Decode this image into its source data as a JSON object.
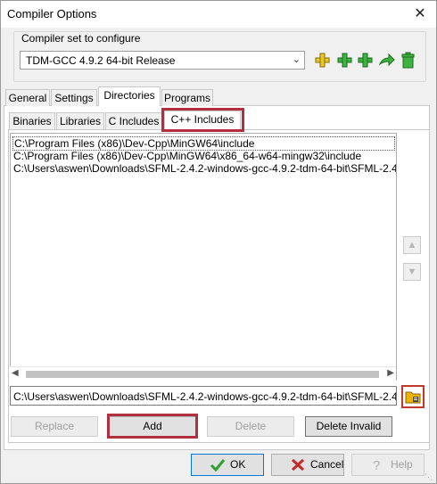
{
  "window": {
    "title": "Compiler Options",
    "close_label": "✕"
  },
  "compiler_set": {
    "label": "Compiler set to configure",
    "selected": "TDM-GCC 4.9.2 64-bit Release",
    "buttons": [
      {
        "name": "add-compiler-set",
        "icon": "plus-yellow-icon"
      },
      {
        "name": "add-green",
        "icon": "plus-green-icon"
      },
      {
        "name": "add-green-2",
        "icon": "plus-green-icon"
      },
      {
        "name": "rename",
        "icon": "arrow-right-icon"
      },
      {
        "name": "delete",
        "icon": "trash-icon"
      }
    ]
  },
  "main_tabs": [
    "General",
    "Settings",
    "Directories",
    "Programs"
  ],
  "main_tab_active": "Directories",
  "sub_tabs": [
    "Binaries",
    "Libraries",
    "C Includes",
    "C++ Includes"
  ],
  "sub_tab_active": "C++ Includes",
  "include_dirs": [
    "C:\\Program Files (x86)\\Dev-Cpp\\MinGW64\\include",
    "C:\\Program Files (x86)\\Dev-Cpp\\MinGW64\\x86_64-w64-mingw32\\include",
    "C:\\Users\\aswen\\Downloads\\SFML-2.4.2-windows-gcc-4.9.2-tdm-64-bit\\SFML-2.4"
  ],
  "path_input": "C:\\Users\\aswen\\Downloads\\SFML-2.4.2-windows-gcc-4.9.2-tdm-64-bit\\SFML-2.4",
  "action_buttons": {
    "replace": "Replace",
    "add": "Add",
    "delete": "Delete",
    "delete_invalid": "Delete Invalid"
  },
  "dialog_buttons": {
    "ok": "OK",
    "cancel": "Cancel",
    "help": "Help"
  },
  "colors": {
    "highlight": "#c0392b",
    "accent_green": "#2e9e2e"
  }
}
